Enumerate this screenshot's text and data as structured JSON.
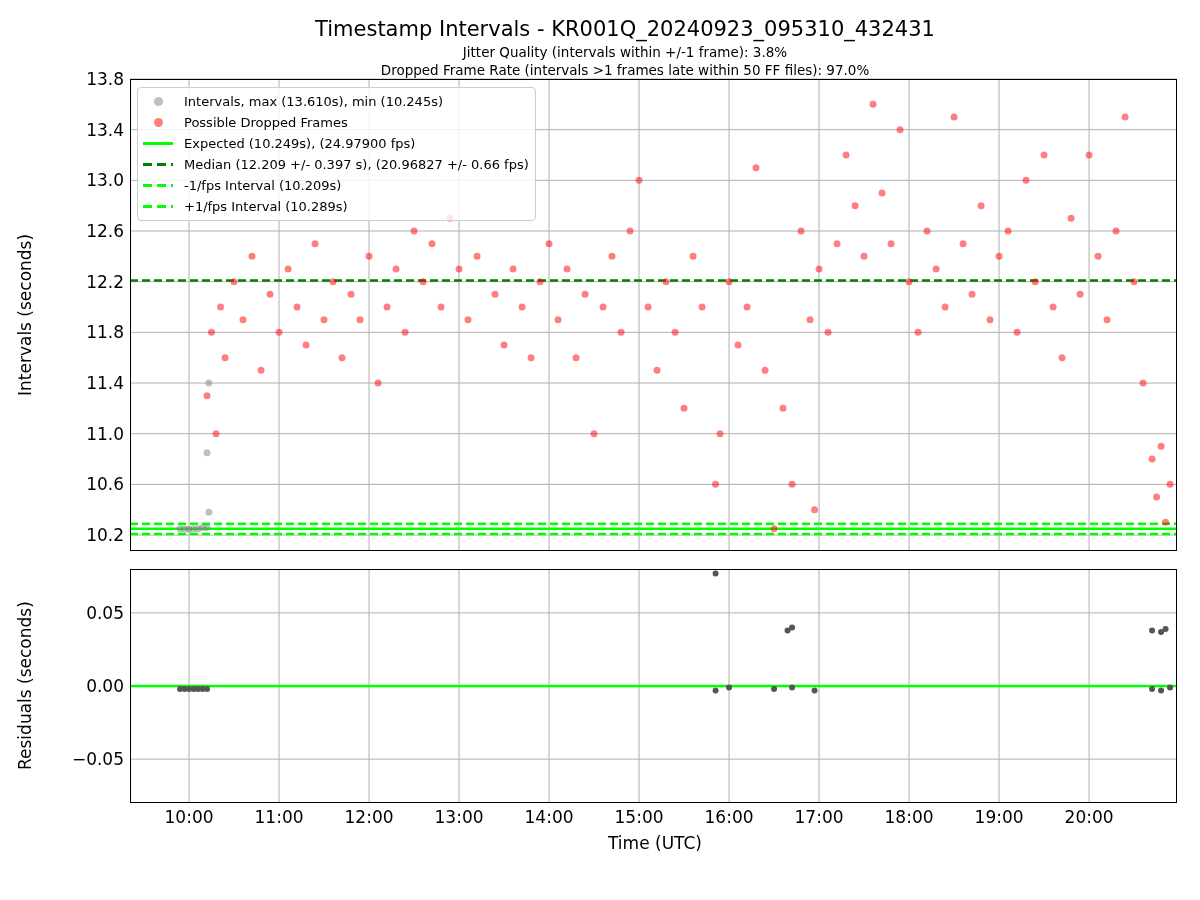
{
  "figure": {
    "title": "Timestamp Intervals - KR001Q_20240923_095310_432431",
    "subtitle_lines": [
      "Jitter Quality (intervals within +/-1 frame): 3.8%",
      "Dropped Frame Rate (intervals >1 frames late within 50 FF files): 97.0%"
    ]
  },
  "intervals_plot": {
    "chart_data": {
      "type": "scatter",
      "ylabel": "Intervals (seconds)",
      "grid": true,
      "legend": true,
      "xlim": [
        9.344,
        20.977
      ],
      "ylim": [
        10.074,
        13.8
      ],
      "yticks": [
        {
          "value": 10.2,
          "label": "10.2"
        },
        {
          "value": 10.6,
          "label": "10.6"
        },
        {
          "value": 11.0,
          "label": "11.0"
        },
        {
          "value": 11.4,
          "label": "11.4"
        },
        {
          "value": 11.8,
          "label": "11.8"
        },
        {
          "value": 12.2,
          "label": "12.2"
        },
        {
          "value": 12.6,
          "label": "12.6"
        },
        {
          "value": 13.0,
          "label": "13.0"
        },
        {
          "value": 13.4,
          "label": "13.4"
        },
        {
          "value": 13.8,
          "label": "13.8"
        }
      ],
      "series": [
        {
          "name": "Intervals, max (13.610s), min (10.245s)",
          "type": "scatter",
          "color": "#808080",
          "x": [
            9.9,
            9.95,
            10.0,
            10.05,
            10.1,
            10.15,
            10.2,
            10.2,
            10.22,
            10.22
          ],
          "values": [
            10.25,
            10.25,
            10.245,
            10.25,
            10.25,
            10.26,
            10.26,
            10.85,
            11.4,
            10.38
          ]
        },
        {
          "name": "Possible Dropped Frames",
          "type": "scatter",
          "color": "#ff0000",
          "x": [
            10.2,
            10.25,
            10.3,
            10.35,
            10.4,
            10.5,
            10.6,
            10.7,
            10.8,
            10.9,
            11.0,
            11.1,
            11.2,
            11.3,
            11.4,
            11.5,
            11.6,
            11.7,
            11.8,
            11.9,
            12.0,
            12.1,
            12.2,
            12.3,
            12.4,
            12.5,
            12.6,
            12.7,
            12.8,
            12.9,
            13.0,
            13.1,
            13.2,
            13.4,
            13.5,
            13.6,
            13.7,
            13.8,
            13.9,
            14.0,
            14.1,
            14.2,
            14.3,
            14.4,
            14.5,
            14.6,
            14.7,
            14.8,
            14.9,
            15.0,
            15.1,
            15.2,
            15.3,
            15.4,
            15.5,
            15.6,
            15.7,
            15.85,
            15.9,
            16.0,
            16.1,
            16.2,
            16.3,
            16.4,
            16.5,
            16.6,
            16.7,
            16.8,
            16.9,
            16.95,
            17.0,
            17.1,
            17.2,
            17.3,
            17.4,
            17.5,
            17.6,
            17.7,
            17.8,
            17.9,
            18.0,
            18.1,
            18.2,
            18.3,
            18.4,
            18.5,
            18.6,
            18.7,
            18.8,
            18.9,
            19.0,
            19.1,
            19.2,
            19.3,
            19.4,
            19.5,
            19.6,
            19.7,
            19.8,
            19.9,
            20.0,
            20.1,
            20.2,
            20.3,
            20.4,
            20.5,
            20.6,
            20.7,
            20.75,
            20.8,
            20.85,
            20.9
          ],
          "values": [
            11.3,
            11.8,
            11.0,
            12.0,
            11.6,
            12.2,
            11.9,
            12.4,
            11.5,
            12.1,
            11.8,
            12.3,
            12.0,
            11.7,
            12.5,
            11.9,
            12.2,
            11.6,
            12.1,
            11.9,
            12.4,
            11.4,
            12.0,
            12.3,
            11.8,
            12.6,
            12.2,
            12.5,
            12.0,
            12.7,
            12.3,
            11.9,
            12.4,
            12.1,
            11.7,
            12.3,
            12.0,
            11.6,
            12.2,
            12.5,
            11.9,
            12.3,
            11.6,
            12.1,
            11.0,
            12.0,
            12.4,
            11.8,
            12.6,
            13.0,
            12.0,
            11.5,
            12.2,
            11.8,
            11.2,
            12.4,
            12.0,
            10.6,
            11.0,
            12.2,
            11.7,
            12.0,
            13.1,
            11.5,
            10.25,
            11.2,
            10.6,
            12.6,
            11.9,
            10.4,
            12.3,
            11.8,
            12.5,
            13.2,
            12.8,
            12.4,
            13.6,
            12.9,
            12.5,
            13.4,
            12.2,
            11.8,
            12.6,
            12.3,
            12.0,
            13.5,
            12.5,
            12.1,
            12.8,
            11.9,
            12.4,
            12.6,
            11.8,
            13.0,
            12.2,
            13.2,
            12.0,
            11.6,
            12.7,
            12.1,
            13.2,
            12.4,
            11.9,
            12.6,
            13.5,
            12.2,
            11.4,
            10.8,
            10.5,
            10.9,
            10.3,
            10.6
          ]
        },
        {
          "name": "Expected (10.249s), (24.97900 fps)",
          "type": "line",
          "line_style": "solid",
          "color": "#00ff00",
          "x": [
            9.344,
            20.977
          ],
          "values": [
            10.249,
            10.249
          ]
        },
        {
          "name": "Median (12.209 +/- 0.397 s), (20.96827 +/- 0.66 fps)",
          "type": "line",
          "line_style": "dashed",
          "color": "#008000",
          "x": [
            9.344,
            20.977
          ],
          "values": [
            12.209,
            12.209
          ]
        },
        {
          "name": "-1/fps Interval (10.209s)",
          "type": "line",
          "line_style": "dashed",
          "color": "#00ff00",
          "x": [
            9.344,
            20.977
          ],
          "values": [
            10.209,
            10.209
          ]
        },
        {
          "name": "+1/fps Interval (10.289s)",
          "type": "line",
          "line_style": "dashed",
          "color": "#00ff00",
          "x": [
            9.344,
            20.977
          ],
          "values": [
            10.289,
            10.289
          ]
        }
      ]
    }
  },
  "residuals_plot": {
    "chart_data": {
      "type": "scatter",
      "xlabel": "Time (UTC)",
      "ylabel": "Residuals (seconds)",
      "grid": true,
      "xlim": [
        9.344,
        20.977
      ],
      "ylim": [
        -0.08,
        0.08
      ],
      "xticks": [
        {
          "value": 10,
          "label": "10:00"
        },
        {
          "value": 11,
          "label": "11:00"
        },
        {
          "value": 12,
          "label": "12:00"
        },
        {
          "value": 13,
          "label": "13:00"
        },
        {
          "value": 14,
          "label": "14:00"
        },
        {
          "value": 15,
          "label": "15:00"
        },
        {
          "value": 16,
          "label": "16:00"
        },
        {
          "value": 17,
          "label": "17:00"
        },
        {
          "value": 18,
          "label": "18:00"
        },
        {
          "value": 19,
          "label": "19:00"
        },
        {
          "value": 20,
          "label": "20:00"
        }
      ],
      "yticks": [
        {
          "value": -0.05,
          "label": "−0.05"
        },
        {
          "value": 0,
          "label": "0.00"
        },
        {
          "value": 0.05,
          "label": "0.05"
        }
      ],
      "series": [
        {
          "type": "scatter",
          "color": "#555555",
          "x": [
            9.9,
            9.95,
            10.0,
            10.05,
            10.1,
            10.15,
            10.2,
            15.85,
            15.85,
            16.0,
            16.5,
            16.65,
            16.7,
            16.7,
            16.95,
            20.7,
            20.8,
            20.85,
            20.7,
            20.8,
            20.9
          ],
          "values": [
            -0.002,
            -0.002,
            -0.002,
            -0.002,
            -0.002,
            -0.002,
            -0.002,
            0.077,
            -0.003,
            -0.001,
            -0.002,
            0.038,
            0.04,
            -0.001,
            -0.003,
            0.038,
            0.037,
            0.039,
            -0.002,
            -0.003,
            -0.001
          ]
        },
        {
          "type": "line",
          "line_style": "solid",
          "color": "#00ff00",
          "x": [
            9.344,
            20.977
          ],
          "values": [
            0,
            0
          ]
        }
      ]
    }
  }
}
